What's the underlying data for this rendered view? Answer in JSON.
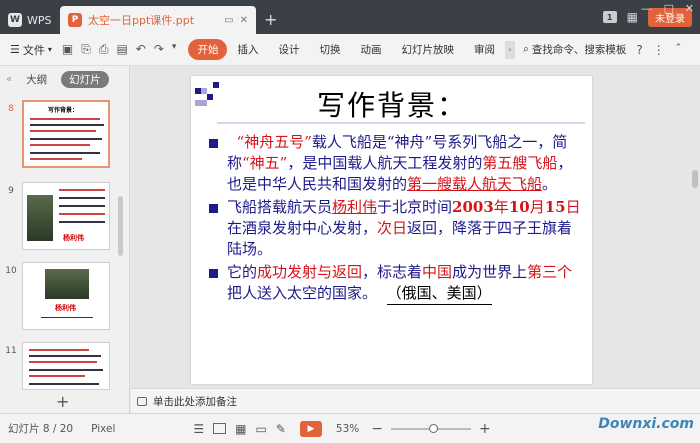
{
  "titlebar": {
    "app_tab": "WPS",
    "document_tab": "太空一日ppt课件.ppt",
    "badge": "1",
    "unlogin": "未登录"
  },
  "toolbar": {
    "file_menu": "文件",
    "tabs": [
      "开始",
      "插入",
      "设计",
      "切换",
      "动画",
      "幻灯片放映",
      "审阅"
    ],
    "active_tab": "开始",
    "search_cmd": "查找命令、搜索模板"
  },
  "left_panel": {
    "tabs": [
      "大纲",
      "幻灯片"
    ],
    "active_tab": "幻灯片",
    "thumbnails": [
      {
        "number": "8",
        "selected": true,
        "title": "写作背景："
      },
      {
        "number": "9",
        "selected": false,
        "label": "杨利伟"
      },
      {
        "number": "10",
        "selected": false,
        "label": "杨利伟"
      },
      {
        "number": "11",
        "selected": false
      }
    ]
  },
  "slide": {
    "title": "写作背景：",
    "bullet1": {
      "p1": "“神舟五号”",
      "p2": "载人飞船是“神舟”号系列飞船之一，简称",
      "p3": "“神五”",
      "p4": "，是中国载人航天工程发射的",
      "p5": "第五艘飞船",
      "p6": "，也是中华人民共和国发射的",
      "p7": "第一艘载人航天飞船",
      "p8": "。"
    },
    "bullet2": {
      "p1": "飞船搭载航天员",
      "p2": "杨利伟",
      "p3": "于北京时间",
      "p4": "2003",
      "p5": "年",
      "p6": "10",
      "p7": "月",
      "p8": "15",
      "p9": "日",
      "p10": "在酒泉发射中心发射，",
      "p11": "次日",
      "p12": "返回，降落于四子王旗着陆场。"
    },
    "bullet3": {
      "p1": "它的",
      "p2": "成功发射与返回",
      "p3": "，标志着",
      "p4": "中国",
      "p5": "成为世界上",
      "p6": "第三个",
      "p7": "把人送入太空的国家。",
      "p8": "（俄国、美国）"
    }
  },
  "notes_placeholder": "单击此处添加备注",
  "status": {
    "slide_counter": "幻灯片 8 / 20",
    "font": "Pixel",
    "zoom": "53%",
    "zoom_fraction": 0.53
  },
  "watermark": "Downxi.com",
  "colors": {
    "accent": "#e2623b",
    "slide_text": "#1e1a8a",
    "slide_red": "#d4141a"
  }
}
